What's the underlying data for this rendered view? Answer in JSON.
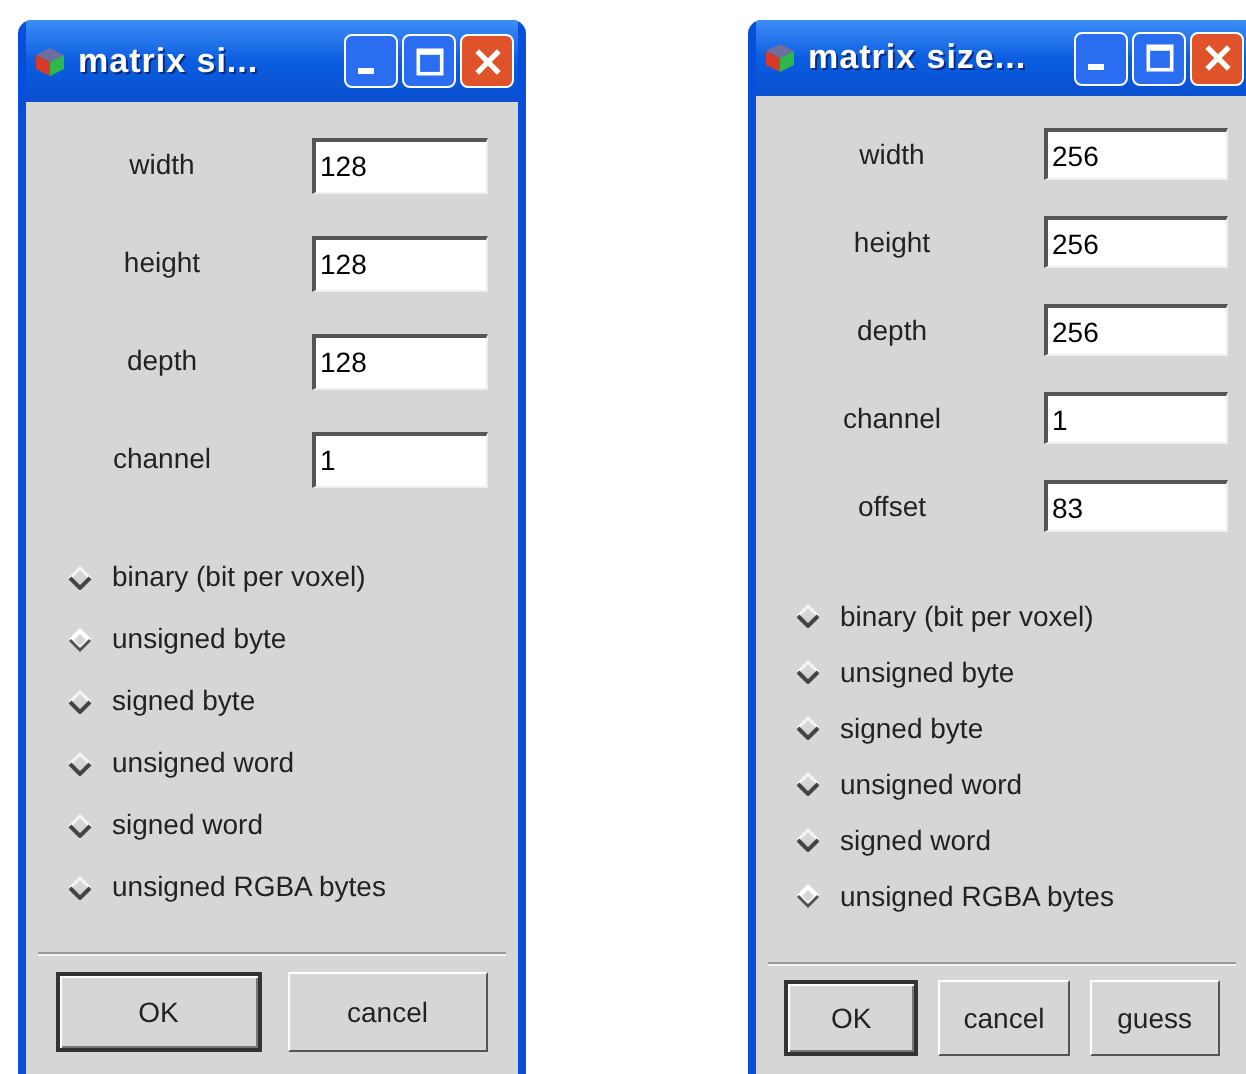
{
  "windows": [
    {
      "title": "matrix si...",
      "fields": [
        {
          "label": "width",
          "value": "128"
        },
        {
          "label": "height",
          "value": "128"
        },
        {
          "label": "depth",
          "value": "128"
        },
        {
          "label": "channel",
          "value": "1"
        }
      ],
      "options": [
        {
          "label": "binary (bit per voxel)",
          "selected": false
        },
        {
          "label": "unsigned byte",
          "selected": true
        },
        {
          "label": "signed byte",
          "selected": false
        },
        {
          "label": "unsigned word",
          "selected": false
        },
        {
          "label": "signed word",
          "selected": false
        },
        {
          "label": "unsigned RGBA bytes",
          "selected": false
        }
      ],
      "buttons": [
        {
          "label": "OK",
          "default": true
        },
        {
          "label": "cancel",
          "default": false
        }
      ]
    },
    {
      "title": "matrix size...",
      "fields": [
        {
          "label": "width",
          "value": "256"
        },
        {
          "label": "height",
          "value": "256"
        },
        {
          "label": "depth",
          "value": "256"
        },
        {
          "label": "channel",
          "value": "1"
        },
        {
          "label": "offset",
          "value": "83"
        }
      ],
      "options": [
        {
          "label": "binary (bit per voxel)",
          "selected": false
        },
        {
          "label": "unsigned byte",
          "selected": false
        },
        {
          "label": "signed byte",
          "selected": false
        },
        {
          "label": "unsigned word",
          "selected": false
        },
        {
          "label": "signed word",
          "selected": false
        },
        {
          "label": "unsigned RGBA bytes",
          "selected": true
        }
      ],
      "buttons": [
        {
          "label": "OK",
          "default": true
        },
        {
          "label": "cancel",
          "default": false
        },
        {
          "label": "guess",
          "default": false
        }
      ]
    }
  ]
}
